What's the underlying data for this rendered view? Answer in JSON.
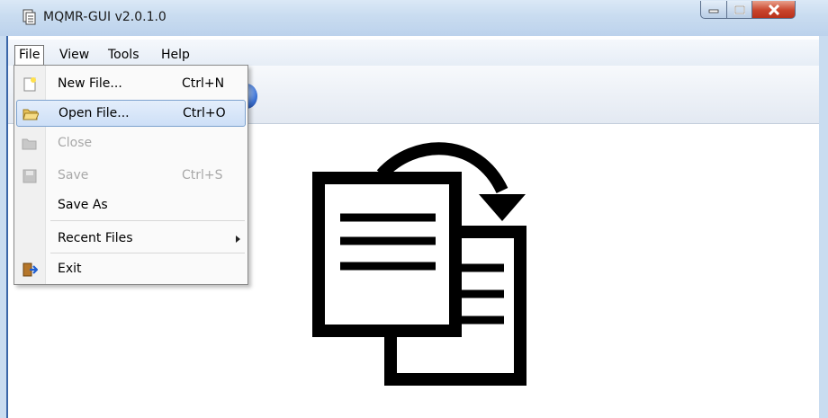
{
  "window": {
    "title": "MQMR-GUI v2.0.1.0",
    "controls": [
      "minimize",
      "maximize",
      "close"
    ]
  },
  "menubar": {
    "items": [
      {
        "label": "File",
        "active": true
      },
      {
        "label": "View",
        "active": false
      },
      {
        "label": "Tools",
        "active": false
      },
      {
        "label": "Help",
        "active": false
      }
    ]
  },
  "file_menu": {
    "items": [
      {
        "label": "New File...",
        "shortcut": "Ctrl+N",
        "icon": "new-file-icon",
        "enabled": true,
        "highlighted": false
      },
      {
        "label": "Open File...",
        "shortcut": "Ctrl+O",
        "icon": "folder-open-icon",
        "enabled": true,
        "highlighted": true
      },
      {
        "label": "Close",
        "shortcut": "",
        "icon": "folder-icon",
        "enabled": false,
        "highlighted": false
      },
      {
        "label": "Save",
        "shortcut": "Ctrl+S",
        "icon": "save-icon",
        "enabled": false,
        "highlighted": false
      },
      {
        "label": "Save As",
        "shortcut": "",
        "icon": "",
        "enabled": true,
        "highlighted": false
      },
      {
        "label": "Recent Files",
        "shortcut": "",
        "icon": "",
        "enabled": true,
        "submenu": true
      },
      {
        "label": "Exit",
        "shortcut": "",
        "icon": "exit-door-icon",
        "enabled": true,
        "highlighted": false
      }
    ]
  },
  "main": {
    "center_icon": "copy-documents-icon",
    "colors": {
      "menu_highlight": "#cddff7",
      "title_bar": "#c9dcf0",
      "close_button": "#c9452c"
    }
  }
}
